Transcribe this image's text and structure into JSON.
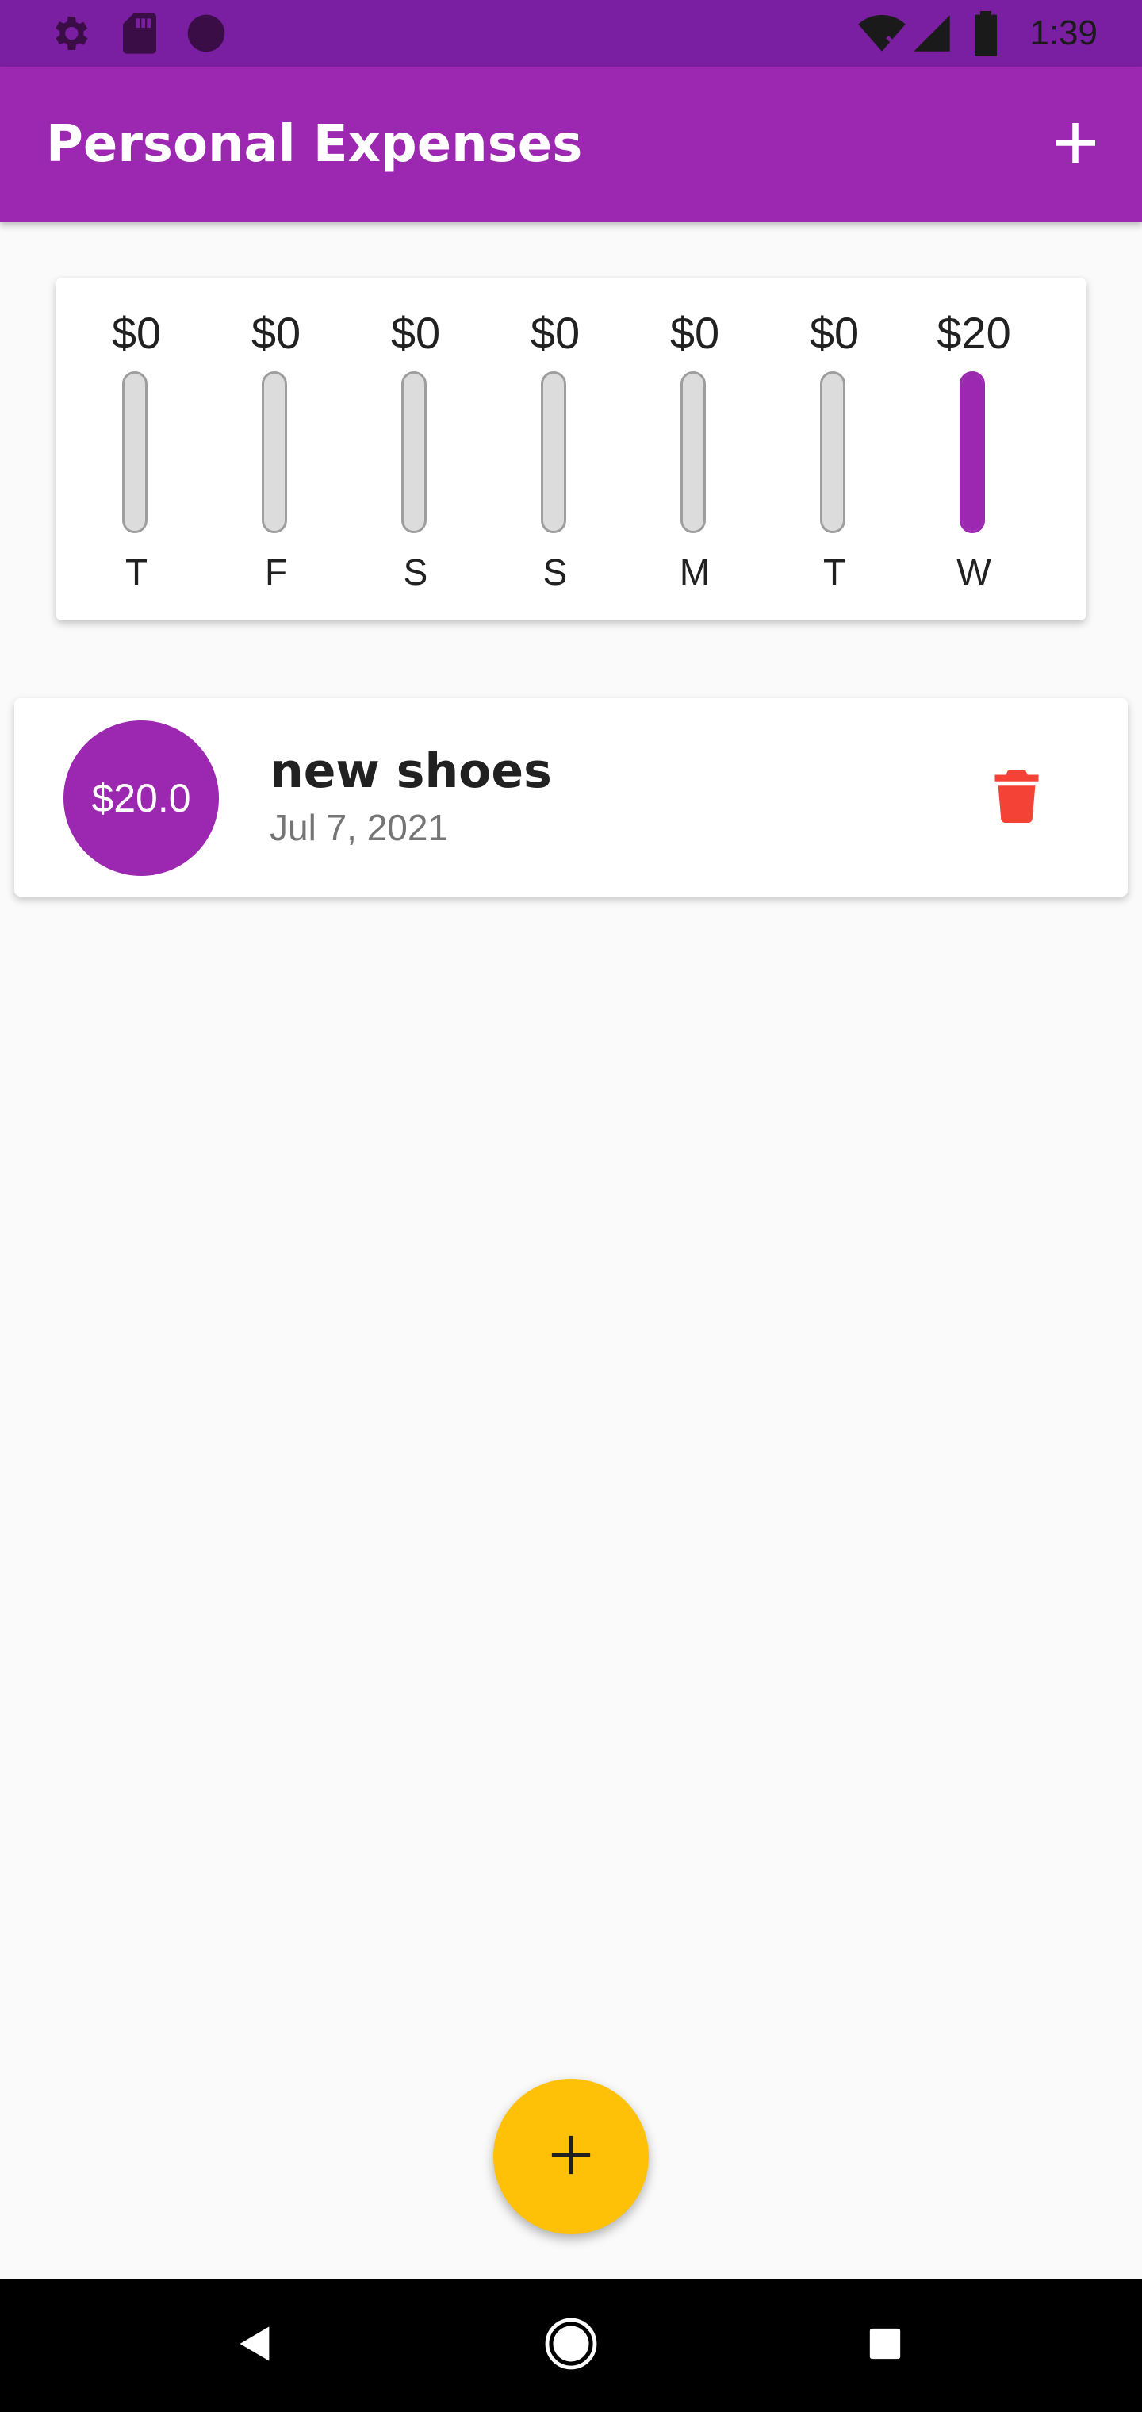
{
  "status_bar": {
    "time": "1:39",
    "left_icons": [
      "gear-icon",
      "sd-card-icon",
      "circle-icon"
    ],
    "right_icons": [
      "wifi-off-icon",
      "cell-signal-icon",
      "battery-icon"
    ]
  },
  "app_bar": {
    "title": "Personal Expenses",
    "add_icon": "plus-icon",
    "color": "#9c27b0"
  },
  "chart_data": {
    "type": "bar",
    "categories": [
      "T",
      "F",
      "S",
      "S",
      "M",
      "T",
      "W"
    ],
    "value_labels": [
      "$0",
      "$0",
      "$0",
      "$0",
      "$0",
      "$0",
      "$20"
    ],
    "values": [
      0,
      0,
      0,
      0,
      0,
      0,
      20
    ],
    "fill_fraction": [
      0,
      0,
      0,
      0,
      0,
      0,
      1
    ],
    "bar_color": "#9c27b0",
    "track_color": "#dcdcdc"
  },
  "transactions": [
    {
      "amount": "$20.0",
      "title": "new shoes",
      "date": "Jul 7, 2021",
      "delete_icon": "trash-icon",
      "delete_color": "#f44336"
    }
  ],
  "fab": {
    "icon": "plus-icon",
    "color": "#ffc107"
  },
  "nav_bar": {
    "icons": [
      "back-icon",
      "home-icon",
      "recents-icon"
    ]
  }
}
